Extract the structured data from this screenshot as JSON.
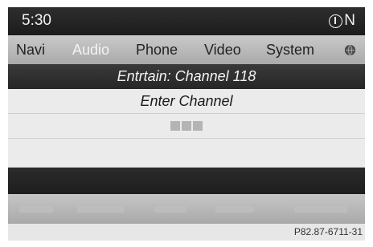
{
  "status": {
    "time": "5:30",
    "heading": "N",
    "compass_icon": "compass-icon"
  },
  "menu": {
    "items": [
      {
        "label": "Navi",
        "active": false
      },
      {
        "label": "Audio",
        "active": true
      },
      {
        "label": "Phone",
        "active": false
      },
      {
        "label": "Video",
        "active": false
      },
      {
        "label": "System",
        "active": false
      }
    ],
    "globe_icon": "globe-icon"
  },
  "title": "Entrtain: Channel 118",
  "enter_channel_label": "Enter Channel",
  "channel_input": {
    "slots": 3
  },
  "reference_code": "P82.87-6711-31",
  "colors": {
    "status_bar": "#1c1c1c",
    "menu_bar": "#aaaaaa",
    "active_menu_text": "#f4f4f4",
    "list_background": "#ebebeb"
  }
}
